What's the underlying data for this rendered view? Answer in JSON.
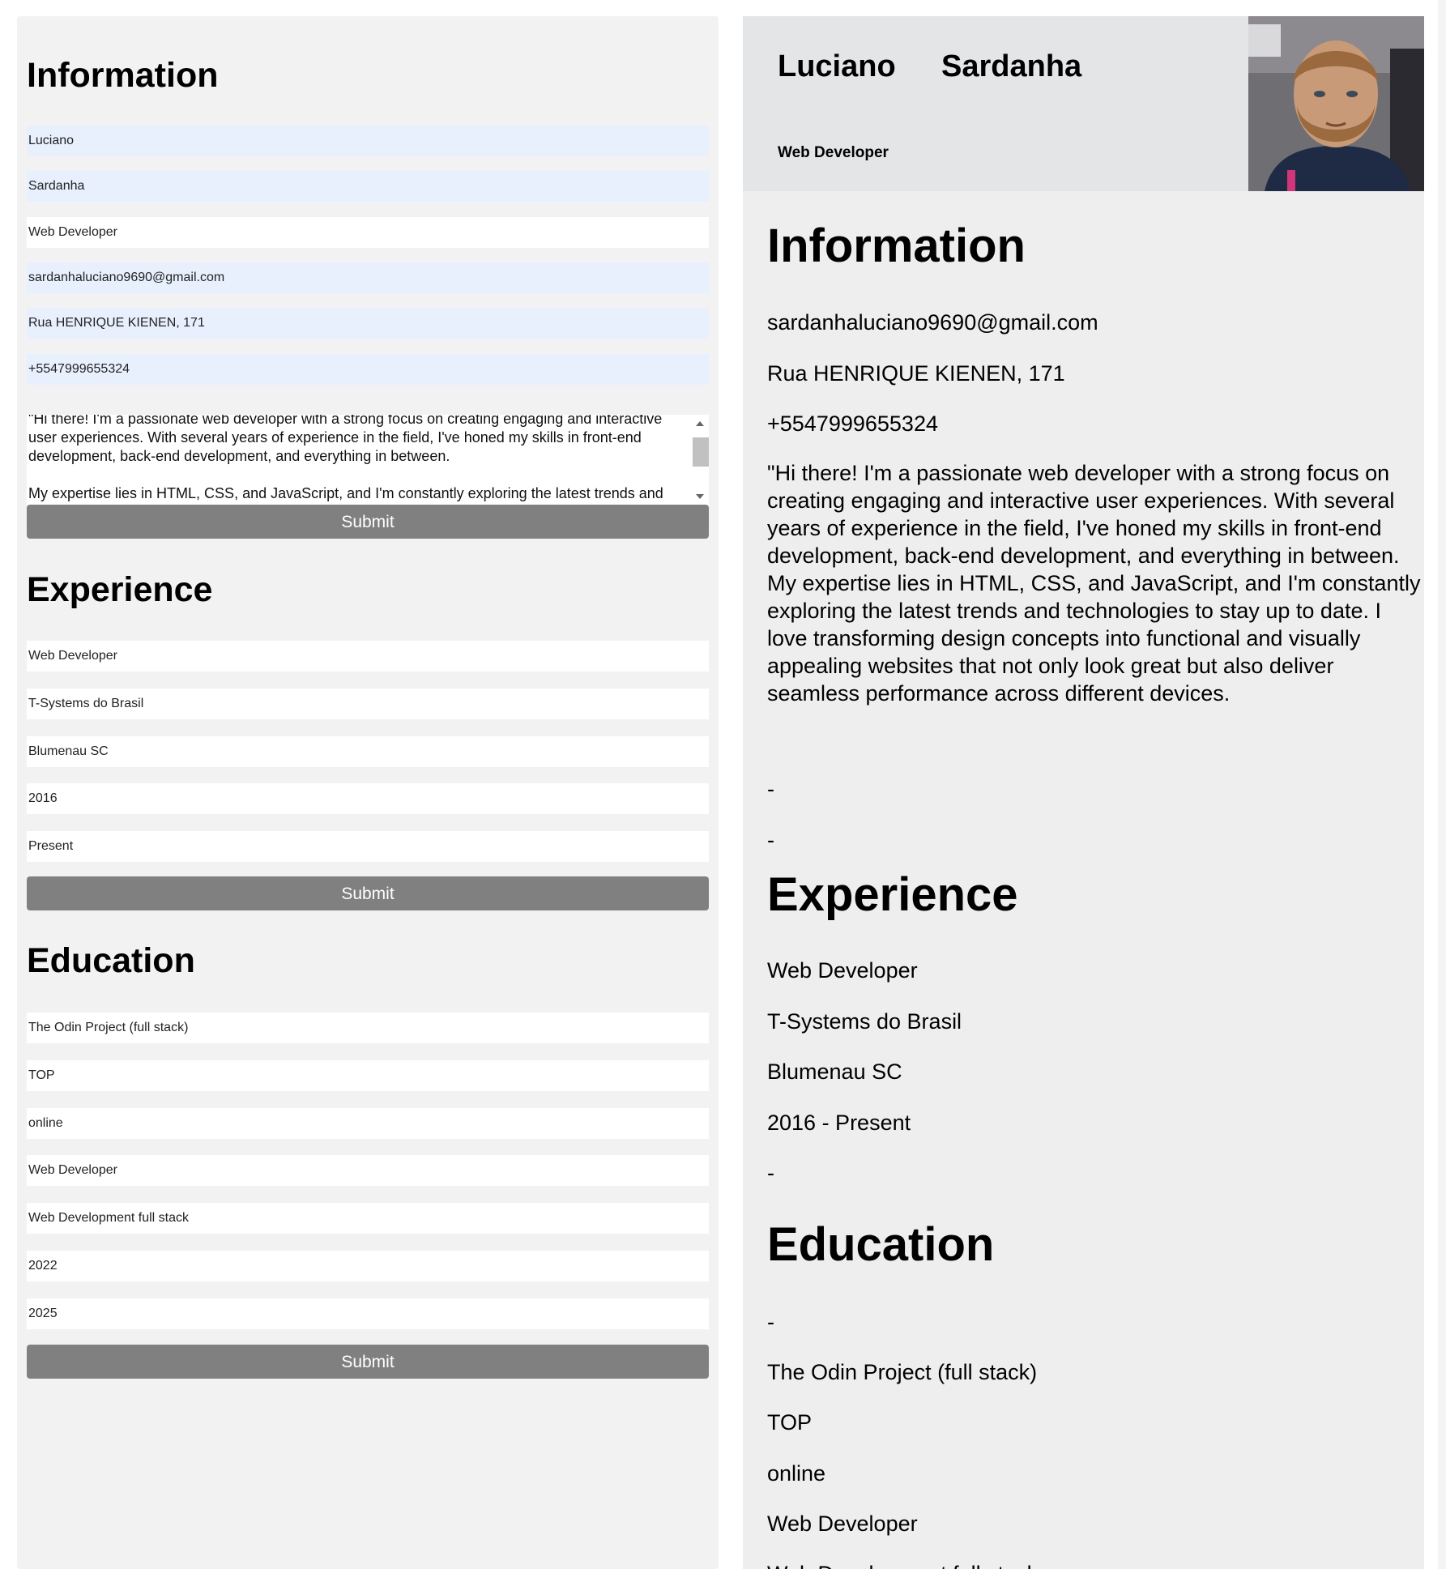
{
  "form": {
    "information": {
      "heading": "Information",
      "first_name": "Luciano",
      "last_name": "Sardanha",
      "title": "Web Developer",
      "email": "sardanhaluciano9690@gmail.com",
      "address": "Rua HENRIQUE KIENEN, 171",
      "phone": "+5547999655324",
      "about": "\"Hi there! I'm a passionate web developer with a strong focus on creating engaging and interactive user experiences. With several years of experience in the field, I've honed my skills in front-end development, back-end development, and everything in between.\n\nMy expertise lies in HTML, CSS, and JavaScript, and I'm constantly exploring the latest trends and technologies to stay up to date. I love transforming design concepts into functional and visually appealing websites that not only look great but also deliver seamless performance across different devices.",
      "submit_label": "Submit"
    },
    "experience": {
      "heading": "Experience",
      "position": "Web Developer",
      "company": "T-Systems do Brasil",
      "location": "Blumenau SC",
      "start": "2016",
      "end": "Present",
      "submit_label": "Submit"
    },
    "education": {
      "heading": "Education",
      "school": "The Odin Project (full stack)",
      "institution": "TOP",
      "location": "online",
      "degree": "Web Developer",
      "course": "Web Development full stack",
      "start": "2022",
      "end": "2025",
      "submit_label": "Submit"
    }
  },
  "cv": {
    "first_name": "Luciano",
    "last_name": "Sardanha",
    "title": "Web Developer",
    "information": {
      "heading": "Information",
      "email": "sardanhaluciano9690@gmail.com",
      "address": "Rua HENRIQUE KIENEN, 171",
      "phone": "+5547999655324",
      "about": "\"Hi there! I'm a passionate web developer with a strong focus on creating engaging and interactive user experiences. With several years of experience in the field, I've honed my skills in front-end development, back-end development, and everything in between. My expertise lies in HTML, CSS, and JavaScript, and I'm constantly exploring the latest trends and technologies to stay up to date. I love transforming design concepts into functional and visually appealing websites that not only look great but also deliver seamless performance across different devices.",
      "dash_1": "-",
      "dash_2": "-"
    },
    "experience": {
      "heading": "Experience",
      "position": "Web Developer",
      "company": "T-Systems do Brasil",
      "location": "Blumenau SC",
      "period": "2016 - Present",
      "dash": "-"
    },
    "education": {
      "heading": "Education",
      "dash": "-",
      "school": "The Odin Project (full stack)",
      "institution": "TOP",
      "location": "online",
      "degree": "Web Developer",
      "course": "Web Development full stack"
    },
    "photo_icon": "profile-photo"
  },
  "colors": {
    "form_bg": "#f2f2f2",
    "autofill_bg": "#e8f0fe",
    "button_bg": "#808080",
    "cv_bg": "#eeeeee",
    "cv_header_bg": "#e4e5e7"
  }
}
